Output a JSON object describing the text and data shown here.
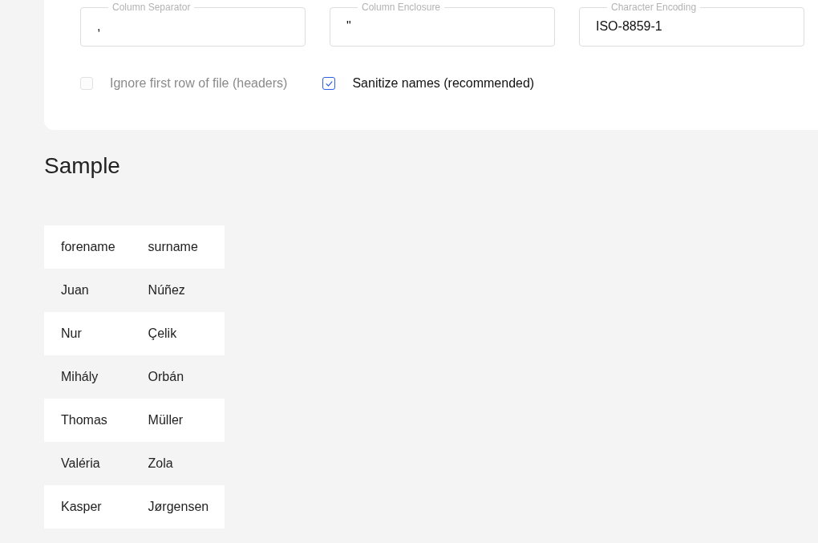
{
  "settings": {
    "fields": [
      {
        "label": "Column Separator",
        "value": ","
      },
      {
        "label": "Column Enclosure",
        "value": "\""
      },
      {
        "label": "Character Encoding",
        "value": "ISO-8859-1"
      }
    ],
    "options": [
      {
        "label": "Ignore first row of file (headers)",
        "checked": false,
        "disabled": true
      },
      {
        "label": "Sanitize names (recommended)",
        "checked": true,
        "disabled": false
      }
    ]
  },
  "sample": {
    "title": "Sample",
    "table": {
      "columns": [
        "forename",
        "surname"
      ],
      "rows": [
        [
          "Juan",
          "Núñez"
        ],
        [
          "Nur",
          "Çelik"
        ],
        [
          "Mihály",
          "Orbán"
        ],
        [
          "Thomas",
          "Müller"
        ],
        [
          "Valéria",
          "Zola"
        ],
        [
          "Kasper",
          "Jørgensen"
        ]
      ]
    }
  }
}
